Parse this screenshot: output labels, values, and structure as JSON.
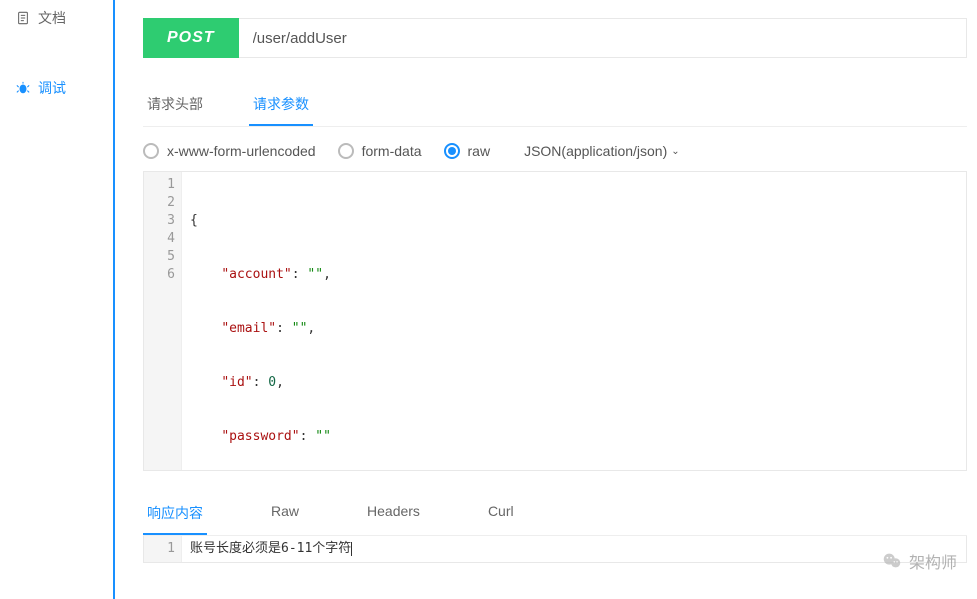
{
  "sidebar": {
    "items": [
      {
        "label": "文档",
        "icon": "doc-icon"
      },
      {
        "label": "调试",
        "icon": "bug-icon"
      }
    ],
    "activeIndex": 1
  },
  "request": {
    "method": "POST",
    "url": "/user/addUser"
  },
  "requestTabs": {
    "items": [
      {
        "label": "请求头部"
      },
      {
        "label": "请求参数"
      }
    ],
    "activeIndex": 1
  },
  "bodyTypes": {
    "items": [
      {
        "label": "x-www-form-urlencoded"
      },
      {
        "label": "form-data"
      },
      {
        "label": "raw"
      }
    ],
    "selectedIndex": 2,
    "contentType": "JSON(application/json)"
  },
  "requestBody": {
    "lines": [
      {
        "n": "1",
        "text": "{"
      },
      {
        "n": "2",
        "text": "    \"account\": \"\","
      },
      {
        "n": "3",
        "text": "    \"email\": \"\","
      },
      {
        "n": "4",
        "text": "    \"id\": 0,"
      },
      {
        "n": "5",
        "text": "    \"password\": \"\""
      },
      {
        "n": "6",
        "text": "}"
      }
    ],
    "json": {
      "account": "",
      "email": "",
      "id": 0,
      "password": ""
    }
  },
  "responseTabs": {
    "items": [
      {
        "label": "响应内容"
      },
      {
        "label": "Raw"
      },
      {
        "label": "Headers"
      },
      {
        "label": "Curl"
      }
    ],
    "activeIndex": 0
  },
  "responseBody": {
    "lines": [
      {
        "n": "1",
        "text": "账号长度必须是6-11个字符"
      }
    ]
  },
  "watermark": {
    "label": "架构师"
  }
}
